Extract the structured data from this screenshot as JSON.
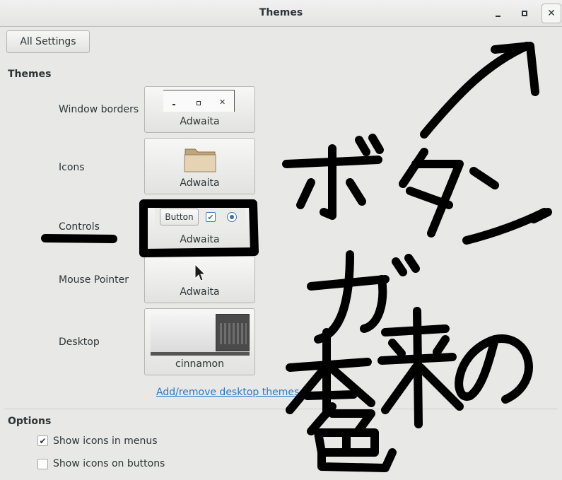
{
  "window": {
    "title": "Themes",
    "buttons": {
      "minimize_icon": "minimize-icon",
      "maximize_icon": "maximize-icon",
      "close_icon": "close-icon"
    }
  },
  "toolbar": {
    "all_settings_label": "All Settings"
  },
  "themes_section": {
    "heading": "Themes",
    "rows": [
      {
        "label": "Window borders",
        "theme": "Adwaita"
      },
      {
        "label": "Icons",
        "theme": "Adwaita"
      },
      {
        "label": "Controls",
        "theme": "Adwaita",
        "preview_button": "Button"
      },
      {
        "label": "Mouse Pointer",
        "theme": "Adwaita"
      },
      {
        "label": "Desktop",
        "theme": "cinnamon"
      }
    ],
    "add_remove_link": "Add/remove desktop themes..."
  },
  "options_section": {
    "heading": "Options",
    "checkboxes": [
      {
        "label": "Show icons in menus",
        "checked": true
      },
      {
        "label": "Show icons on buttons",
        "checked": false
      }
    ]
  },
  "colors": {
    "link": "#2a76c6",
    "ink": "#000000",
    "folder": "#d8c3a0"
  }
}
